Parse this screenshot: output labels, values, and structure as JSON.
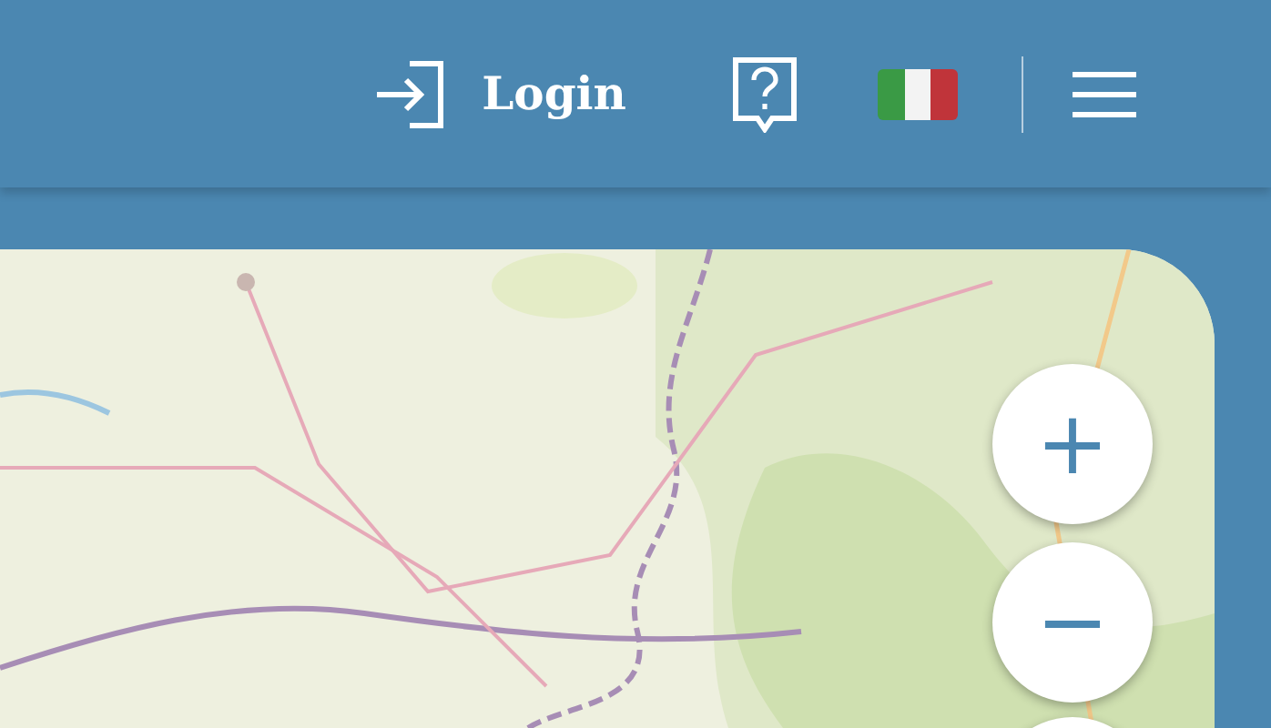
{
  "header": {
    "login": "Login"
  },
  "zoom_controls": [
    "+",
    "−"
  ]
}
